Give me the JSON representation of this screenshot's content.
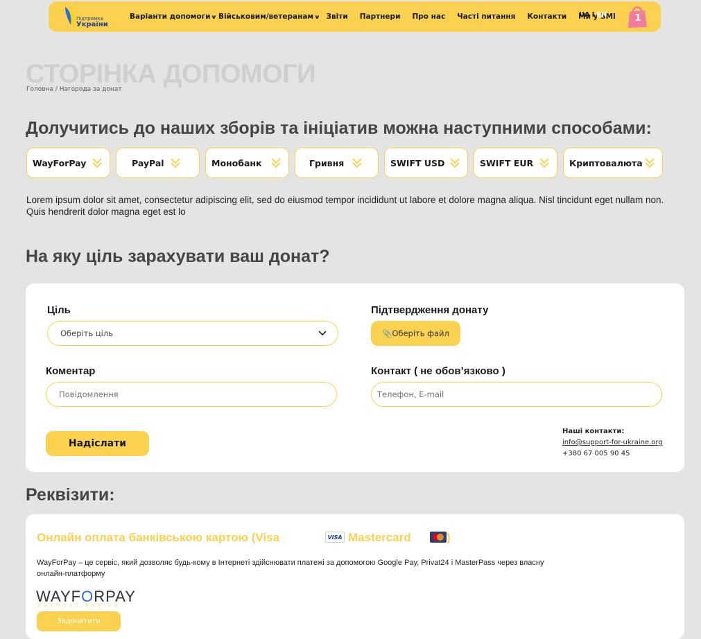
{
  "header": {
    "logo_line1": "Підтримка",
    "logo_line2": "України",
    "nav": [
      {
        "label": "Варіанти допомоги",
        "has_dropdown": true
      },
      {
        "label": "Військовим/ветеранам",
        "has_dropdown": true
      },
      {
        "label": "Звіти",
        "has_dropdown": false
      },
      {
        "label": "Партнери",
        "has_dropdown": false
      },
      {
        "label": "Про нас",
        "has_dropdown": false
      },
      {
        "label": "Часті питання",
        "has_dropdown": false
      },
      {
        "label": "Контакти",
        "has_dropdown": false
      },
      {
        "label": "Ми у ЗМІ",
        "has_dropdown": false
      }
    ],
    "lang_ua": "UA",
    "lang_sep": "I",
    "lang_en": "EN",
    "cart_count": "1",
    "accent": "#fbd250"
  },
  "page": {
    "title": "СТОРІНКА ДОПОМОГИ",
    "breadcrumb": "Головна / Нагорода за донат",
    "ways_heading": "Долучитись до наших зборів та ініціатив можна наступними способами:",
    "methods": [
      "WayForPay",
      "PayPal",
      "Монобанк",
      "Гривня",
      "SWIFT USD",
      "SWIFT EUR",
      "Криптовалюта"
    ],
    "lorem": "Lorem ipsum dolor sit amet, consectetur adipiscing elit, sed do eiusmod tempor incididunt ut labore et dolore magna aliqua. Nisl tincidunt eget nullam non. Quis hendrerit dolor magna eget est lo",
    "goal_heading": "На яку ціль зарахувати ваш донат?",
    "requisites_heading": "Реквізити:"
  },
  "form": {
    "goal_label": "Ціль",
    "goal_placeholder": "Оберіть ціль",
    "confirm_label": "Підтвердження донату",
    "file_button": "📎Оберіть файл",
    "comment_label": "Коментар",
    "comment_placeholder": "Повідомлення",
    "contact_label": "Контакт ( не обов’язково )",
    "contact_placeholder": "Телефон, E-mail",
    "submit": "Надіслати",
    "contacts_title": "Наші контакти:",
    "contacts_email": "info@support-for-ukraine.org",
    "contacts_phone": "+380 67 005 90 45"
  },
  "requisites": {
    "title_part1": "Онлайн оплата банківською картою (Visa",
    "visa_badge": "VISA",
    "title_part2": "Mastercard",
    "title_part3": ")",
    "description": "WayForPay – це сервіс, який дозволяє будь-кому в Інтернеті здійснювати платежі за допомогою Google Pay, Privat24 і MasterPass через власну онлайн-платформу",
    "logo_a": "WAYF",
    "logo_o": "O",
    "logo_b": "RPAY",
    "logo_sub": "payment engine",
    "donate_button": "Задонатити"
  }
}
